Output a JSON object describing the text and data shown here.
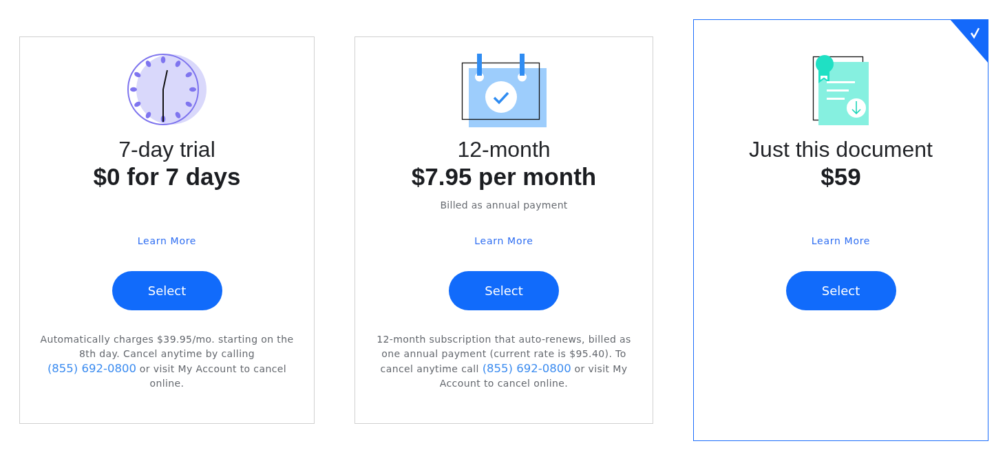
{
  "plans": [
    {
      "kind": "trial",
      "selected": false,
      "title": "7-day trial",
      "price": "$0 for 7 days",
      "learn_more": "Learn More",
      "button": "Select",
      "terms": {
        "before": "Automatically charges $39.95/mo. starting on the 8th day. Cancel anytime by calling ",
        "phone": "(855) 692-0800",
        "after": " or visit My Account to cancel online."
      }
    },
    {
      "kind": "annual",
      "selected": false,
      "title": "12-month",
      "price": "$7.95 per month",
      "note": "Billed as annual payment",
      "learn_more": "Learn More",
      "button": "Select",
      "terms": {
        "before": "12-month subscription that auto-renews, billed as one annual payment (current rate is $95.40). To cancel anytime call ",
        "phone": "(855) 692-0800",
        "after": " or visit My Account to cancel online."
      }
    },
    {
      "kind": "single",
      "selected": true,
      "title": "Just this document",
      "price": "$59",
      "learn_more": "Learn More",
      "button": "Select"
    }
  ]
}
